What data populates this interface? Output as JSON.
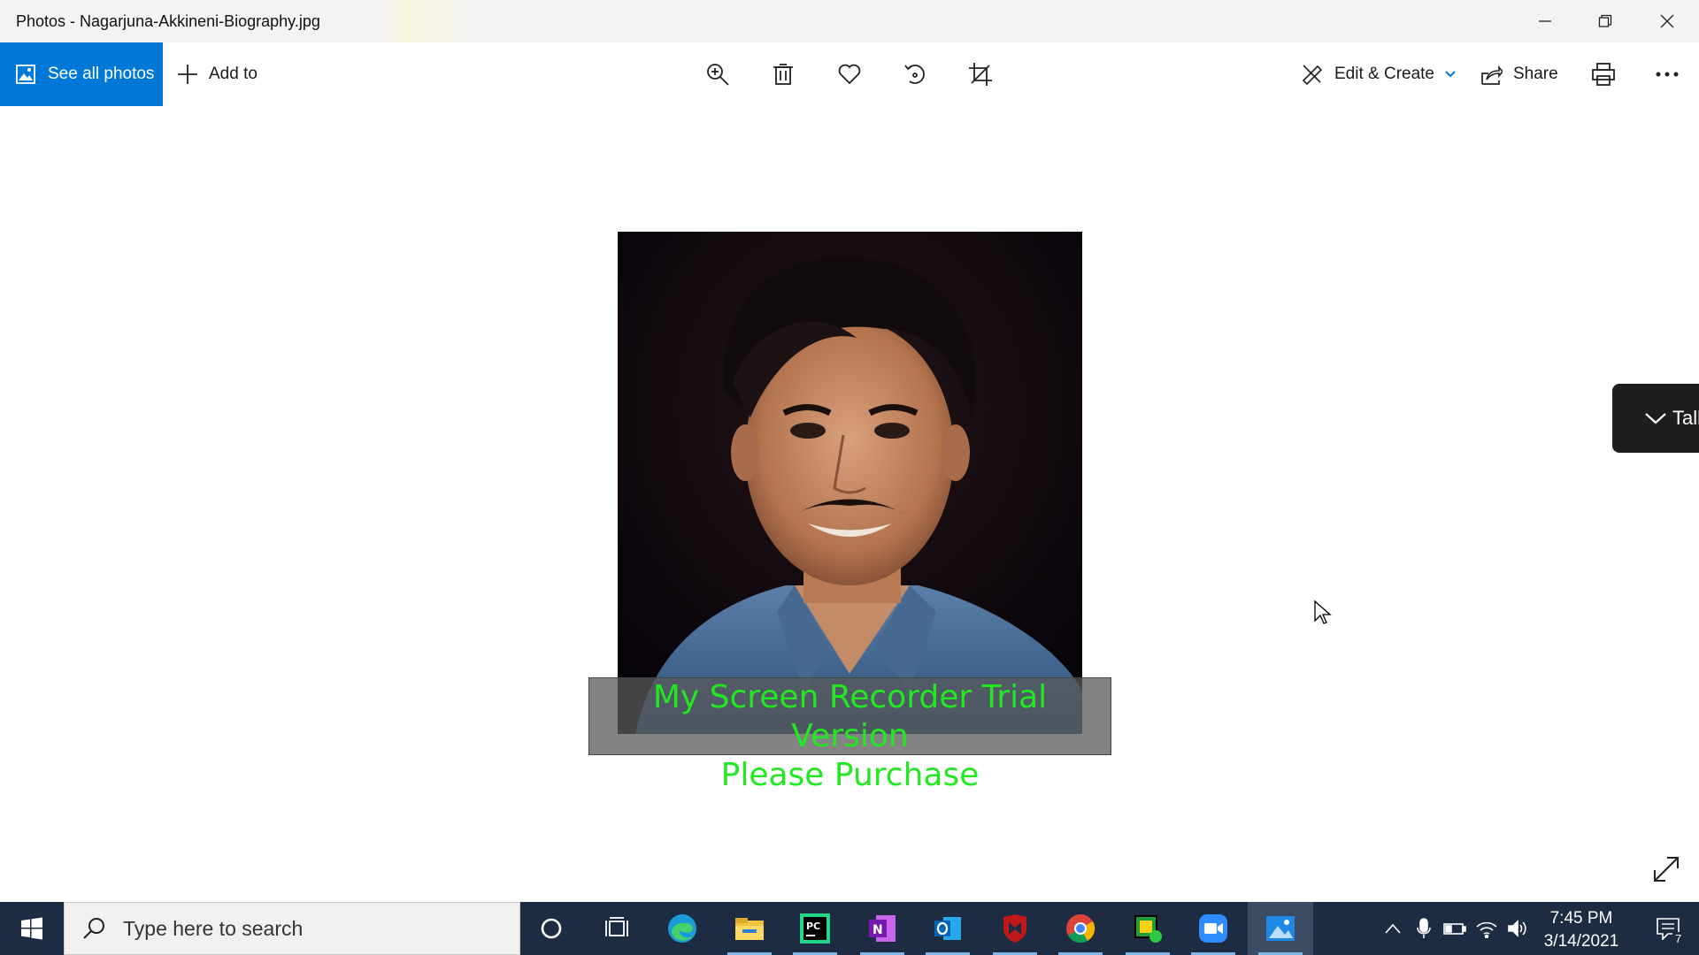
{
  "window": {
    "title": "Photos - Nagarjuna-Akkineni-Biography.jpg",
    "controls": [
      "minimize-icon",
      "restore-icon",
      "close-icon"
    ]
  },
  "toolbar": {
    "see_all_photos": "See all photos",
    "add_to": "Add to",
    "center_tools": [
      "zoom-icon",
      "delete-icon",
      "favorite-icon",
      "rotate-icon",
      "crop-icon"
    ],
    "edit_create": "Edit & Create",
    "share": "Share",
    "print_icon": "print-icon",
    "more_icon": "more-icon"
  },
  "photo": {
    "watermark_line1": "My Screen Recorder Trial Version",
    "watermark_line2": "Please Purchase"
  },
  "side_panel": {
    "label": "Talk"
  },
  "taskbar": {
    "search_placeholder": "Type here to search",
    "apps": [
      "cortana-icon",
      "task-view-icon",
      "edge-icon",
      "file-explorer-icon",
      "pycharm-icon",
      "onenote-icon",
      "outlook-icon",
      "mcafee-icon",
      "chrome-icon",
      "app-icon",
      "zoom-icon",
      "photos-icon"
    ],
    "time": "7:45 PM",
    "date": "3/14/2021",
    "notification_count": "7"
  },
  "colors": {
    "accent": "#0078d7",
    "taskbar": "#1d2c42",
    "watermark_text": "#22e822"
  }
}
